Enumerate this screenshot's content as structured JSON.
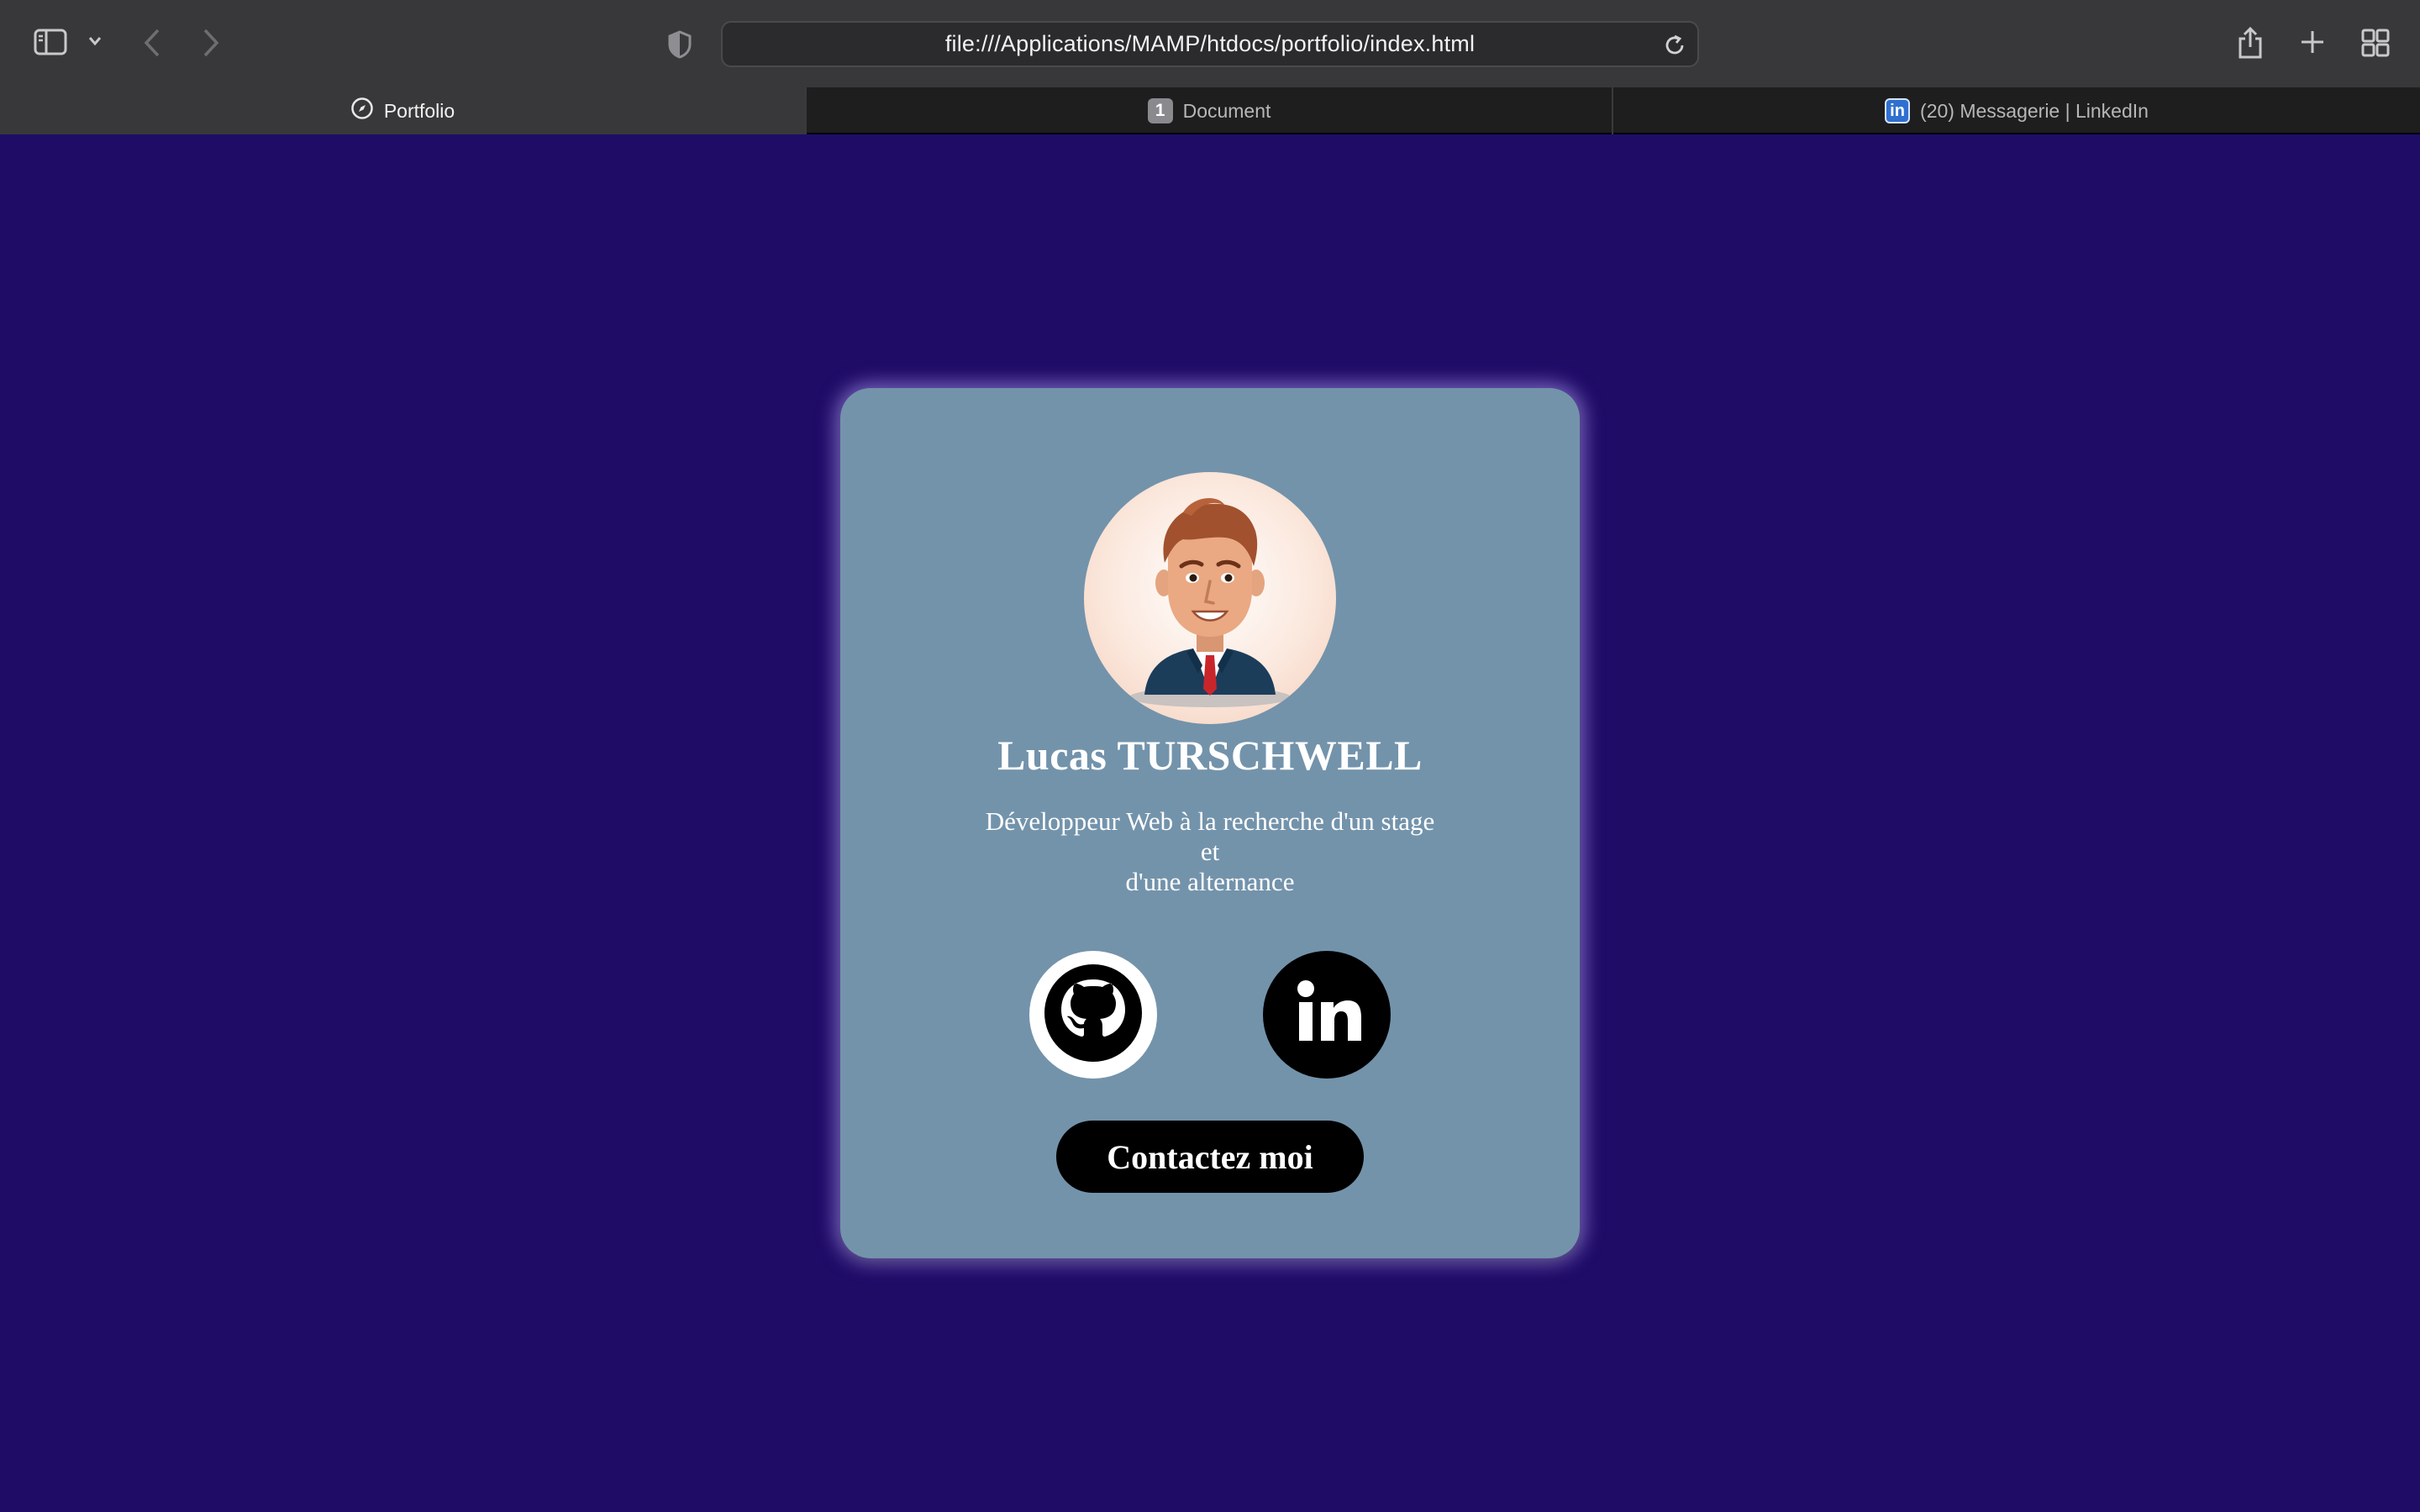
{
  "browser": {
    "url": "file:///Applications/MAMP/htdocs/portfolio/index.html",
    "tabs": [
      {
        "label": "Portfolio",
        "icon": "compass-icon",
        "active": true
      },
      {
        "label": "Document",
        "badge": "1",
        "active": false
      },
      {
        "label": "(20) Messagerie | LinkedIn",
        "badge": "in",
        "active": false
      }
    ]
  },
  "profile": {
    "name": "Lucas TURSCHWELL",
    "tagline_line1": "Développeur Web à la recherche d'un stage",
    "tagline_line2": "et",
    "tagline_line3": "d'une alternance",
    "contact_label": "Contactez moi",
    "socials": [
      "github-icon",
      "linkedin-icon"
    ]
  },
  "colors": {
    "page_background": "#1f0c67",
    "card_background": "#7393ab",
    "button_background": "#000000"
  }
}
